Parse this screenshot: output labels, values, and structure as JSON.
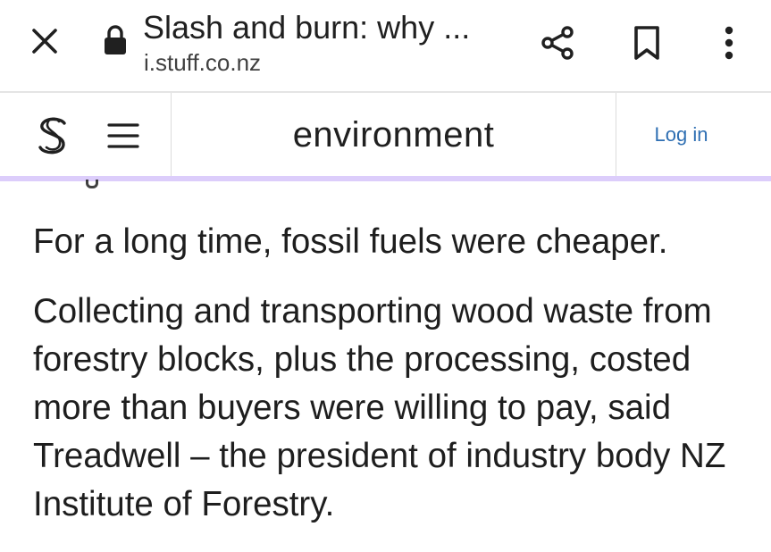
{
  "browser": {
    "title": "Slash and burn: why ...",
    "url": "i.stuff.co.nz"
  },
  "site_header": {
    "section": "environment",
    "login_label": "Log in"
  },
  "article": {
    "paragraphs": [
      "For a long time, fossil fuels were cheaper.",
      "Collecting and transporting wood waste from forestry blocks, plus the processing, costed more than buyers were willing to pay, said Treadwell – the president of industry body NZ Institute of Forestry."
    ]
  },
  "icons": {
    "close": "close-icon",
    "lock": "lock-icon",
    "share": "share-icon",
    "bookmark": "bookmark-icon",
    "menu": "more-vert-icon",
    "logo": "stuff-logo-icon",
    "hamburger": "hamburger-icon"
  },
  "colors": {
    "accent_line": "#dccdfb",
    "link": "#2f6fb3",
    "text": "#1e1e1e"
  }
}
